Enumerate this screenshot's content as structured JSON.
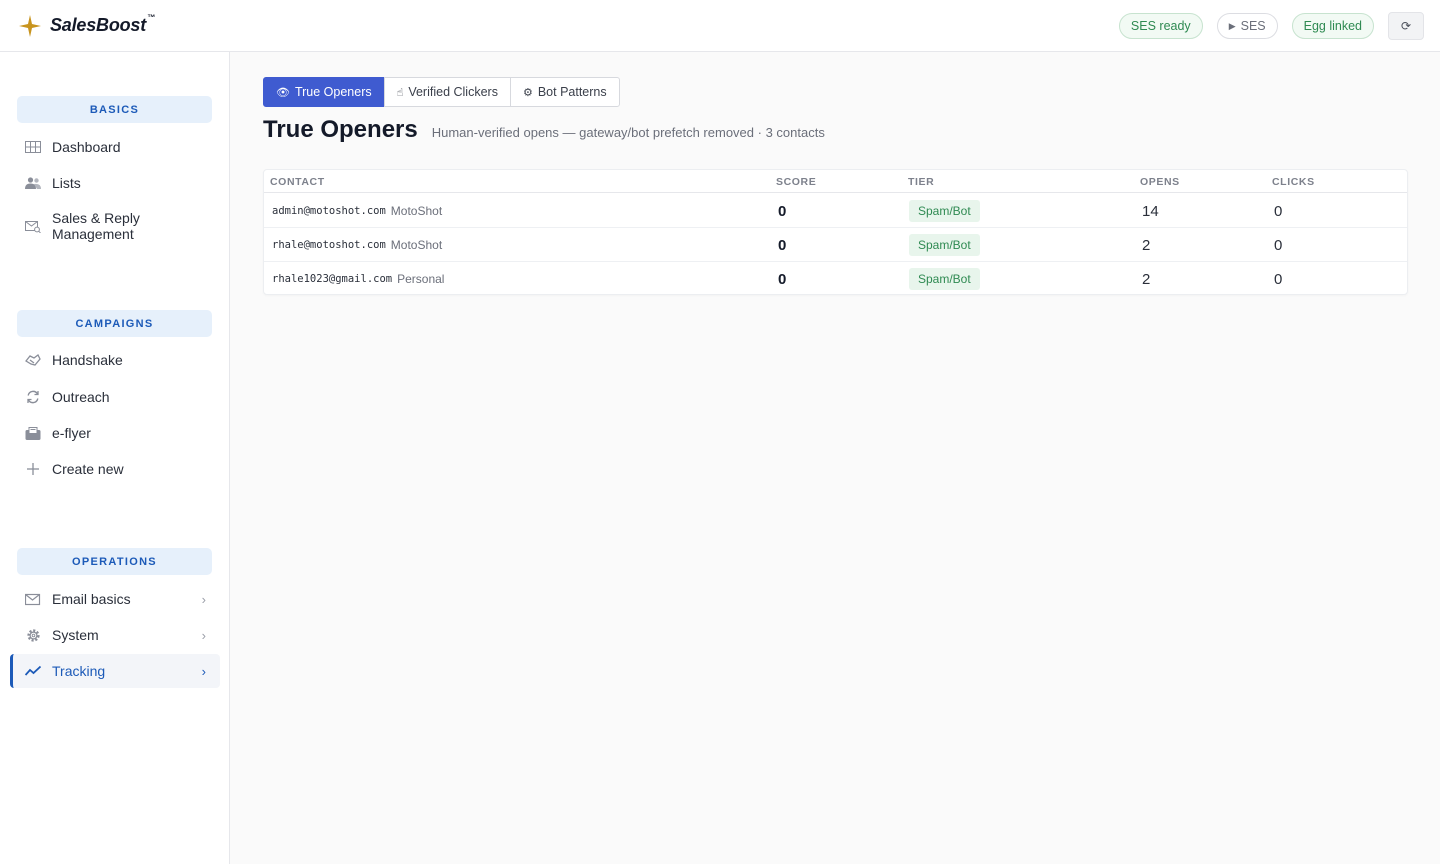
{
  "brand": {
    "name": "SalesBoost",
    "tm": "™",
    "accent": "#c8941e"
  },
  "header": {
    "ses_ready": "SES ready",
    "ses_run": "SES",
    "egg_linked": "Egg linked",
    "refresh": "⟳"
  },
  "sidebar": {
    "sections": [
      {
        "label": "BASICS"
      },
      {
        "label": "CAMPAIGNS"
      },
      {
        "label": "OPERATIONS"
      }
    ],
    "items": [
      {
        "label": "Dashboard",
        "icon": "grid-icon"
      },
      {
        "label": "Lists",
        "icon": "users-icon"
      },
      {
        "label": "Sales & Reply",
        "label2": "Management",
        "icon": "mail-search-icon"
      },
      {
        "label": "Handshake",
        "icon": "handshake-icon"
      },
      {
        "label": "Outreach",
        "icon": "refresh-icon"
      },
      {
        "label": "e-flyer",
        "icon": "flyer-icon"
      },
      {
        "label": "Create new",
        "icon": "plus-icon"
      },
      {
        "label": "Email basics",
        "icon": "mail-icon"
      },
      {
        "label": "System",
        "icon": "gear-icon"
      },
      {
        "label": "Tracking",
        "icon": "trend-icon"
      }
    ]
  },
  "tabs": [
    {
      "label": "True Openers",
      "icon": "eye-icon"
    },
    {
      "label": "Verified Clickers",
      "icon": "pointer-icon"
    },
    {
      "label": "Bot Patterns",
      "icon": "robot-icon"
    }
  ],
  "main": {
    "title": "True Openers",
    "subtitle": "Human-verified opens — gateway/bot prefetch removed · 3 contacts"
  },
  "table": {
    "columns": [
      "CONTACT",
      "SCORE",
      "TIER",
      "OPENS",
      "CLICKS"
    ],
    "rows": [
      {
        "email": "admin@motoshot.com",
        "org": "MotoShot",
        "score": "0",
        "tier": "Spam/Bot",
        "opens": "14",
        "clicks": "0"
      },
      {
        "email": "rhale@motoshot.com",
        "org": "MotoShot",
        "score": "0",
        "tier": "Spam/Bot",
        "opens": "2",
        "clicks": "0"
      },
      {
        "email": "rhale1023@gmail.com",
        "org": "Personal",
        "score": "0",
        "tier": "Spam/Bot",
        "opens": "2",
        "clicks": "0"
      }
    ]
  },
  "colors": {
    "primary": "#3f5bd0",
    "sidebar_accent": "#1c5ab8",
    "badge_green": "#2f8a52"
  }
}
